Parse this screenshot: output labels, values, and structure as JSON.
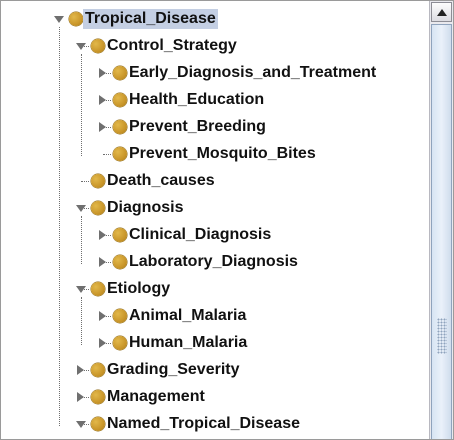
{
  "tree": {
    "nodes": [
      {
        "label": "Tropical_Disease",
        "state": "expanded",
        "selected": true
      },
      {
        "label": "Control_Strategy",
        "state": "expanded"
      },
      {
        "label": "Early_Diagnosis_and_Treatment",
        "state": "collapsed"
      },
      {
        "label": "Health_Education",
        "state": "collapsed"
      },
      {
        "label": "Prevent_Breeding",
        "state": "collapsed"
      },
      {
        "label": "Prevent_Mosquito_Bites",
        "state": "leaf"
      },
      {
        "label": "Death_causes",
        "state": "leaf"
      },
      {
        "label": "Diagnosis",
        "state": "expanded"
      },
      {
        "label": "Clinical_Diagnosis",
        "state": "collapsed"
      },
      {
        "label": "Laboratory_Diagnosis",
        "state": "collapsed"
      },
      {
        "label": "Etiology",
        "state": "expanded"
      },
      {
        "label": "Animal_Malaria",
        "state": "collapsed"
      },
      {
        "label": "Human_Malaria",
        "state": "collapsed"
      },
      {
        "label": "Grading_Severity",
        "state": "collapsed"
      },
      {
        "label": "Management",
        "state": "collapsed"
      },
      {
        "label": "Named_Tropical_Disease",
        "state": "expanded"
      }
    ]
  },
  "icons": {
    "node": "class-dot-icon",
    "expanded": "triangle-down-icon",
    "collapsed": "triangle-right-icon",
    "scroll_up": "arrow-up-icon"
  },
  "colors": {
    "node_dot": "#c9962a",
    "selection": "#c4cfe3",
    "connector": "#6f6f6f"
  }
}
